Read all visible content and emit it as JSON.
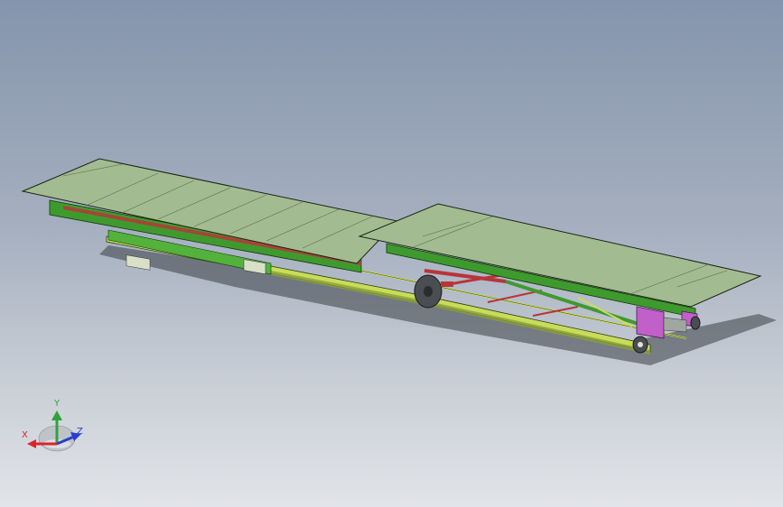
{
  "viewport": {
    "background_top": "#8595ad",
    "background_bottom": "#e2e4e8"
  },
  "model": {
    "deck_color": "#a3bb90",
    "frame_color": "#3f9a2e",
    "rail_color": "#c9dc5a",
    "red_part_color": "#b8353a",
    "pink_part_color": "#c060c8",
    "wheel_color": "#4a4d52"
  },
  "triad": {
    "x_label": "X",
    "y_label": "Y",
    "z_label": "Z",
    "x_color": "#d9262b",
    "y_color": "#2fa33a",
    "z_color": "#2a3fcf",
    "icon": "coordinate-triad-icon"
  }
}
